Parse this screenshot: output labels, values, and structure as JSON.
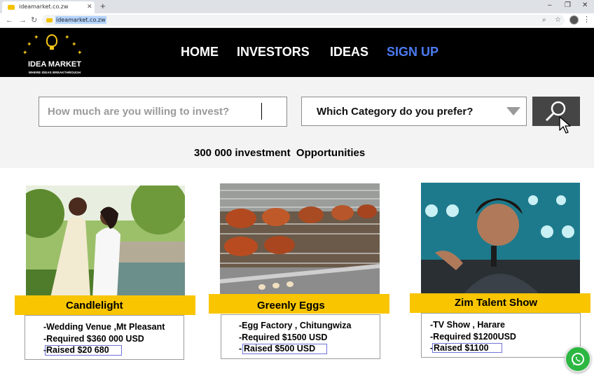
{
  "browser": {
    "tab_title": "ideamarket.co.zw",
    "url": "ideamarket.co.zw"
  },
  "site": {
    "logo_title": "IDEA MARKET",
    "logo_tagline": "WHERE IDEAS BREAKTHROUGH",
    "nav": [
      "HOME",
      "INVESTORS",
      "IDEAS",
      "SIGN UP"
    ],
    "nav_accent_color": "#4c7bf3",
    "brand_color": "#f8c500"
  },
  "search": {
    "invest_placeholder": "How much are you willing to invest?",
    "category_label": "Which Category do you prefer?",
    "opportunities_text": "300 000 investment  Opportunities"
  },
  "cards": [
    {
      "name": "Candlelight",
      "line1": "-Wedding Venue ,Mt Pleasant",
      "line2": "-Required $360 000 USD",
      "raised": "Raised  $20 680"
    },
    {
      "name": "Greenly Eggs",
      "line1": "-Egg Factory , Chitungwiza",
      "line2": "-Required $1500 USD",
      "raised": "Raised  $500 USD"
    },
    {
      "name": "Zim Talent Show",
      "line1": "-TV Show , Harare",
      "line2": "-Required $1200USD",
      "raised": "Raised  $1100"
    }
  ]
}
